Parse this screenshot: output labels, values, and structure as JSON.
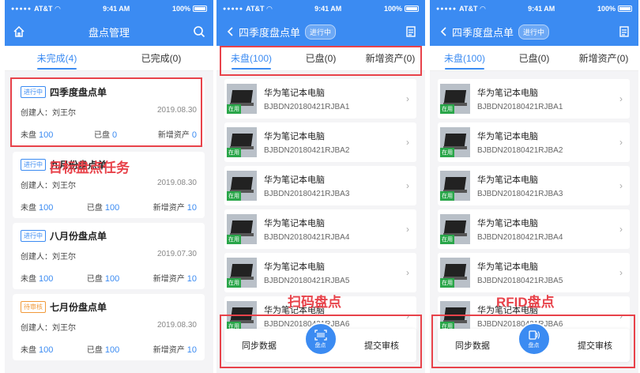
{
  "status": {
    "carrier": "AT&T",
    "time": "9:41 AM",
    "battery": "100%"
  },
  "screen1": {
    "title": "盘点管理",
    "tabs": [
      "未完成(4)",
      "已完成(0)"
    ],
    "cards": [
      {
        "tag": "进行中",
        "title": "四季度盘点单",
        "creator": "创建人：刘王尔",
        "date": "2019.08.30",
        "c1": "未盘",
        "n1": "100",
        "c2": "已盘",
        "n2": "0",
        "c3": "新增资产",
        "n3": "0"
      },
      {
        "tag": "进行中",
        "title": "九月份盘点单",
        "creator": "创建人：刘王尔",
        "date": "2019.08.30",
        "c1": "未盘",
        "n1": "100",
        "c2": "已盘",
        "n2": "100",
        "c3": "新增资产",
        "n3": "10"
      },
      {
        "tag": "进行中",
        "title": "八月份盘点单",
        "creator": "创建人：刘王尔",
        "date": "2019.07.30",
        "c1": "未盘",
        "n1": "100",
        "c2": "已盘",
        "n2": "100",
        "c3": "新增资产",
        "n3": "10"
      },
      {
        "tag": "待审核",
        "title": "七月份盘点单",
        "creator": "创建人：刘王尔",
        "date": "2019.08.30",
        "c1": "未盘",
        "n1": "100",
        "c2": "已盘",
        "n2": "100",
        "c3": "新增资产",
        "n3": "10"
      }
    ],
    "annotation": "目标盘点任务"
  },
  "screen2": {
    "title": "四季度盘点单",
    "badge": "进行中",
    "tabs": [
      "未盘(100)",
      "已盘(0)",
      "新增资产(0)"
    ],
    "items": [
      {
        "name": "华为笔记本电脑",
        "code": "BJBDN20180421RJBA1",
        "status": "在用"
      },
      {
        "name": "华为笔记本电脑",
        "code": "BJBDN20180421RJBA2",
        "status": "在用"
      },
      {
        "name": "华为笔记本电脑",
        "code": "BJBDN20180421RJBA3",
        "status": "在用"
      },
      {
        "name": "华为笔记本电脑",
        "code": "BJBDN20180421RJBA4",
        "status": "在用"
      },
      {
        "name": "华为笔记本电脑",
        "code": "BJBDN20180421RJBA5",
        "status": "在用"
      },
      {
        "name": "华为笔记本电脑",
        "code": "BJBDN20180421RJBA6",
        "status": "在用"
      }
    ],
    "sync": "同步数据",
    "scan": "盘点",
    "submit": "提交审核",
    "annotation": "扫码盘点"
  },
  "screen3": {
    "title": "四季度盘点单",
    "badge": "进行中",
    "tabs": [
      "未盘(100)",
      "已盘(0)",
      "新增资产(0)"
    ],
    "items": [
      {
        "name": "华为笔记本电脑",
        "code": "BJBDN20180421RJBA1",
        "status": "在用"
      },
      {
        "name": "华为笔记本电脑",
        "code": "BJBDN20180421RJBA2",
        "status": "在用"
      },
      {
        "name": "华为笔记本电脑",
        "code": "BJBDN20180421RJBA3",
        "status": "在用"
      },
      {
        "name": "华为笔记本电脑",
        "code": "BJBDN20180421RJBA4",
        "status": "在用"
      },
      {
        "name": "华为笔记本电脑",
        "code": "BJBDN20180421RJBA5",
        "status": "在用"
      },
      {
        "name": "华为笔记本电脑",
        "code": "BJBDN20180421RJBA6",
        "status": "在用"
      }
    ],
    "sync": "同步数据",
    "scan": "盘点",
    "submit": "提交审核",
    "annotation": "RFID盘点"
  },
  "colors": {
    "primary": "#3b8bf2",
    "annotation": "#e8424a",
    "inuse": "#2aa64a",
    "pending": "#f19a3a"
  }
}
